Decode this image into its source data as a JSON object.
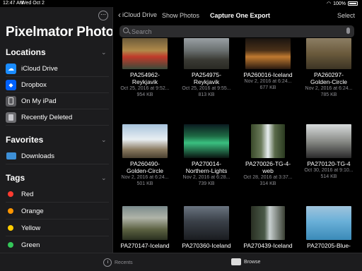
{
  "status": {
    "time": "12:47 AM",
    "date": "Wed Oct 2",
    "battery": "100%"
  },
  "sidebar": {
    "more_label": "⋯",
    "app_title": "Pixelmator Photo",
    "locations": {
      "header": "Locations",
      "items": [
        {
          "label": "iCloud Drive",
          "icon": "icloud-icon"
        },
        {
          "label": "Dropbox",
          "icon": "dropbox-icon"
        },
        {
          "label": "On My iPad",
          "icon": "ipad-icon"
        },
        {
          "label": "Recently Deleted",
          "icon": "trash-icon"
        }
      ]
    },
    "favorites": {
      "header": "Favorites",
      "items": [
        {
          "label": "Downloads",
          "icon": "folder-icon"
        }
      ]
    },
    "tags": {
      "header": "Tags",
      "items": [
        {
          "label": "Red",
          "color": "#ff3b30"
        },
        {
          "label": "Orange",
          "color": "#ff9500"
        },
        {
          "label": "Yellow",
          "color": "#ffcc00"
        },
        {
          "label": "Green",
          "color": "#34c759"
        }
      ]
    }
  },
  "nav": {
    "back_label": "iCloud Drive",
    "show_photos": "Show Photos",
    "title": "Capture One Export",
    "select": "Select"
  },
  "search": {
    "placeholder": "Search"
  },
  "files": [
    {
      "name": [
        "PA254962-",
        "Reykjavik"
      ],
      "meta": [
        "Oct 25, 2016 at 9:52...",
        "954 KB"
      ]
    },
    {
      "name": [
        "PA254975-",
        "Reykjavik"
      ],
      "meta": [
        "Oct 25, 2016 at 9:55...",
        "813 KB"
      ]
    },
    {
      "name": [
        "PA260016-Iceland"
      ],
      "meta": [
        "Nov 2, 2016 at 6:24...",
        "677 KB"
      ]
    },
    {
      "name": [
        "PA260297-",
        "Golden-Circle"
      ],
      "meta": [
        "Nov 2, 2016 at 6:24...",
        "785 KB"
      ]
    },
    {
      "name": [
        "PA260490-",
        "Golden-Circle"
      ],
      "meta": [
        "Nov 2, 2016 at 6:24...",
        "501 KB"
      ]
    },
    {
      "name": [
        "PA270014-",
        "Northern-Lights"
      ],
      "meta": [
        "Nov 2, 2016 at 6:28...",
        "739 KB"
      ]
    },
    {
      "name": [
        "PA270026-TG-4-",
        "web"
      ],
      "meta": [
        "Oct 28, 2016 at 3:37...",
        "314 KB"
      ]
    },
    {
      "name": [
        "PA270120-TG-4"
      ],
      "meta": [
        "Oct 30, 2016 at 9:10...",
        "514 KB"
      ]
    },
    {
      "name": [
        "PA270147-Iceland"
      ],
      "meta": []
    },
    {
      "name": [
        "PA270360-Iceland"
      ],
      "meta": []
    },
    {
      "name": [
        "PA270439-Iceland"
      ],
      "meta": []
    },
    {
      "name": [
        "PA270205-Blue-"
      ],
      "meta": []
    }
  ],
  "tabbar": {
    "recents": "Recents",
    "browse": "Browse"
  }
}
